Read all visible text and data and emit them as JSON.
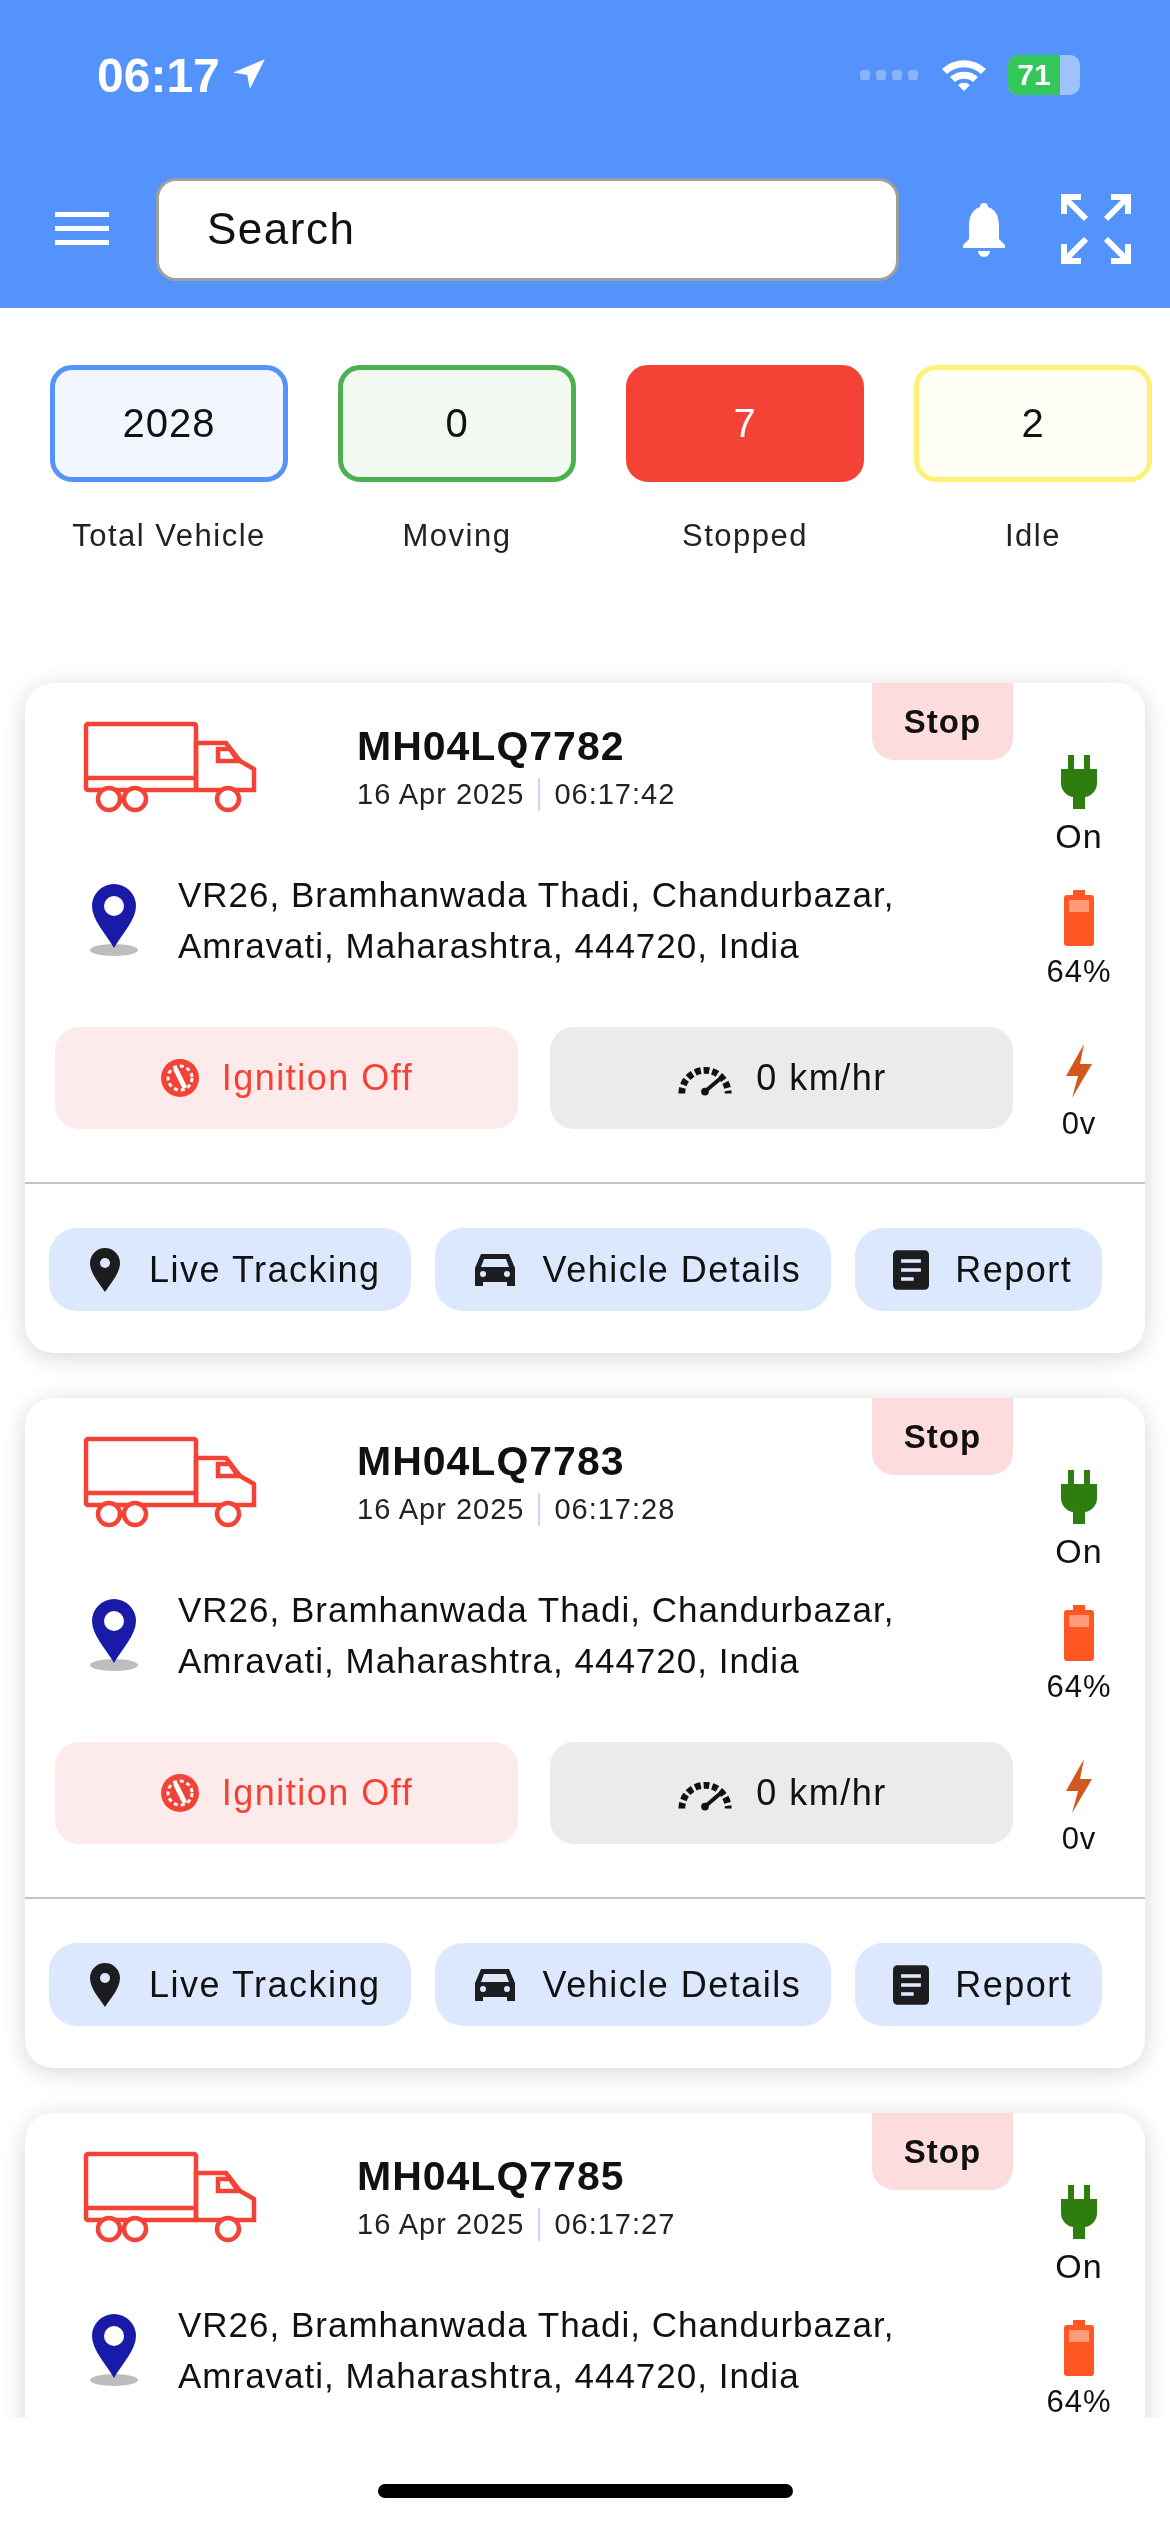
{
  "status_bar": {
    "time": "06:17",
    "battery": "71"
  },
  "search": {
    "placeholder": "Search"
  },
  "stats": [
    {
      "value": "2028",
      "label": "Total Vehicle",
      "kind": "outline",
      "color": "#5393fb"
    },
    {
      "value": "0",
      "label": "Moving",
      "kind": "outline",
      "color": "#4caf50"
    },
    {
      "value": "7",
      "label": "Stopped",
      "kind": "filled",
      "color": "#f44336"
    },
    {
      "value": "2",
      "label": "Idle",
      "kind": "outline",
      "color": "#fff176"
    }
  ],
  "vehicles": [
    {
      "plate": "MH04LQ7782",
      "date": "16 Apr 2025",
      "time": "06:17:42",
      "status": "Stop",
      "power": "On",
      "battery": "64%",
      "voltage": "0v",
      "address": "VR26, Bramhanwada Thadi, Chandurbazar, Amravati, Maharashtra, 444720, India",
      "ignition": "Ignition Off",
      "speed": "0 km/hr",
      "actions": [
        {
          "label": "Live Tracking",
          "kind": "tracking"
        },
        {
          "label": "Vehicle Details",
          "kind": "details"
        },
        {
          "label": "Report",
          "kind": "reports"
        }
      ]
    },
    {
      "plate": "MH04LQ7783",
      "date": "16 Apr 2025",
      "time": "06:17:28",
      "status": "Stop",
      "power": "On",
      "battery": "64%",
      "voltage": "0v",
      "address": "VR26, Bramhanwada Thadi, Chandurbazar, Amravati, Maharashtra, 444720, India",
      "ignition": "Ignition Off",
      "speed": "0 km/hr",
      "actions": [
        {
          "label": "Live Tracking",
          "kind": "tracking"
        },
        {
          "label": "Vehicle Details",
          "kind": "details"
        },
        {
          "label": "Report",
          "kind": "reports"
        }
      ]
    },
    {
      "plate": "MH04LQ7785",
      "date": "16 Apr 2025",
      "time": "06:17:27",
      "status": "Stop",
      "power": "On",
      "battery": "64%",
      "address": "VR26, Bramhanwada Thadi, Chandurbazar, Amravati, Maharashtra, 444720, India"
    }
  ]
}
